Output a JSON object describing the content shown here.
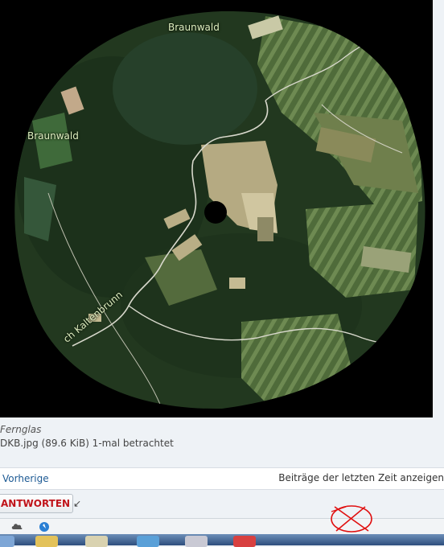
{
  "image": {
    "map_labels": [
      "Braunwald",
      "Braunwald",
      "ch Kaltenbrunn"
    ]
  },
  "attachment": {
    "title": "Fernglas",
    "meta": "DKB.jpg (89.6 KiB) 1-mal betrachtet"
  },
  "nav": {
    "previous_label": "Vorherige",
    "recent_posts_label": "Beiträge der letzten Zeit anzeigen"
  },
  "reply": {
    "label": "ANTWORTEN",
    "arrow": "↙"
  },
  "icons": [
    "cloud-icon",
    "compass-icon",
    "explorer-icon",
    "folder-icon",
    "ie-icon",
    "network-icon",
    "opera-icon"
  ],
  "colors": {
    "reply_text": "#c0141a",
    "link": "#1d5a94",
    "scribble": "#e01010"
  }
}
